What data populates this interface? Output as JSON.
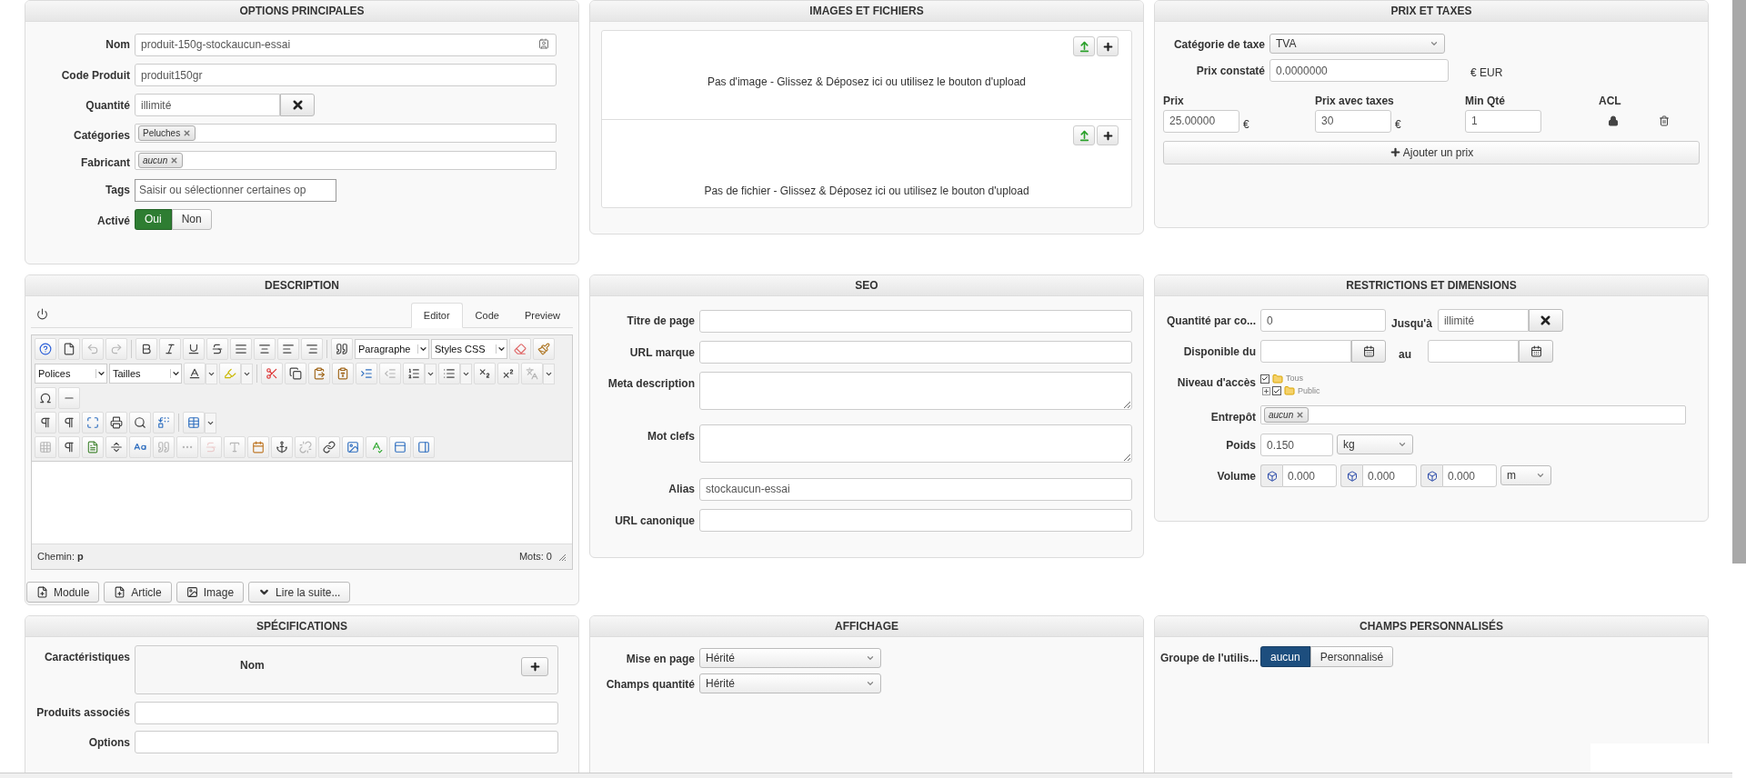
{
  "main_options": {
    "title": "OPTIONS PRINCIPALES",
    "fields": [
      {
        "kind": "text_icon",
        "label": "Nom",
        "value": "produit-150g-stockaucun-essai"
      },
      {
        "kind": "text",
        "label": "Code Produit",
        "value": "produit150gr"
      },
      {
        "kind": "clearable",
        "label": "Quantité",
        "value": "illimité"
      },
      {
        "kind": "tags",
        "label": "Catégories",
        "tags": [
          {
            "label": "Peluches",
            "italic": false
          }
        ]
      },
      {
        "kind": "tags",
        "label": "Fabricant",
        "tags": [
          {
            "label": "aucun",
            "italic": true
          }
        ]
      },
      {
        "kind": "placeholder",
        "label": "Tags",
        "placeholder": "Saisir ou sélectionner certaines op"
      },
      {
        "kind": "toggle",
        "label": "Activé",
        "color": "#2e7d32",
        "options": [
          {
            "label": "Oui",
            "selected": true
          },
          {
            "label": "Non",
            "selected": false
          }
        ]
      }
    ]
  },
  "images": {
    "title": "IMAGES ET FICHIERS",
    "dropzones": [
      {
        "text": "Pas d'image - Glissez & Déposez ici ou utilisez le bouton d'upload"
      },
      {
        "text": "Pas de fichier - Glissez & Déposez ici ou utilisez le bouton d'upload"
      }
    ]
  },
  "prices": {
    "title": "PRIX ET TAXES",
    "tax_category": {
      "label": "Catégorie de taxe",
      "value": "TVA"
    },
    "list_price": {
      "label": "Prix constaté",
      "value": "0.0000000",
      "currency": "€ EUR"
    },
    "price_columns": [
      "Prix",
      "Prix avec taxes",
      "Min Qté",
      "ACL"
    ],
    "price_rows": [
      {
        "price": "25.00000",
        "price_currency": "€",
        "price_tax": "30",
        "tax_currency": "€",
        "min_qty": "1"
      }
    ],
    "add_button": "Ajouter un prix"
  },
  "description": {
    "title": "DESCRIPTION",
    "tabs": [
      {
        "label": "Editor",
        "selected": true
      },
      {
        "label": "Code",
        "selected": false
      },
      {
        "label": "Preview",
        "selected": false
      }
    ],
    "selects": [
      "Paragraphe",
      "Styles CSS",
      "Polices",
      "Tailles"
    ],
    "path": "Chemin: **p**",
    "word_count": "Mots: 0",
    "buttons": [
      {
        "label": "Module",
        "kind": "insert"
      },
      {
        "label": "Article",
        "kind": "insert"
      },
      {
        "label": "Image",
        "kind": "image"
      },
      {
        "label": "Lire la suite...",
        "kind": "readmore"
      }
    ]
  },
  "seo": {
    "title": "SEO",
    "fields": [
      {
        "kind": "text",
        "label": "Titre de page"
      },
      {
        "kind": "text",
        "label": "URL marque"
      },
      {
        "kind": "textarea",
        "label": "Meta description"
      },
      {
        "kind": "textarea",
        "label": "Mot clefs"
      },
      {
        "kind": "text",
        "label": "Alias",
        "value": "stockaucun-essai"
      },
      {
        "kind": "text",
        "label": "URL canonique"
      }
    ]
  },
  "restrictions": {
    "title": "RESTRICTIONS ET DIMENSIONS",
    "fields": [
      {
        "kind": "quantity_range",
        "label": "Quantité par co...",
        "value": "0",
        "to_label": "Jusqu'à",
        "to_value": "illimité"
      },
      {
        "kind": "date_range",
        "label": "Disponible du",
        "to_label": "au"
      },
      {
        "kind": "tree",
        "label": "Niveau d'accès",
        "items": [
          {
            "label": "Tous",
            "checked": true,
            "children": [
              {
                "label": "Public",
                "checked": true,
                "expanded": false
              }
            ]
          }
        ]
      },
      {
        "kind": "tags",
        "label": "Entrepôt",
        "tags": [
          {
            "label": "aucun",
            "italic": true
          }
        ]
      },
      {
        "kind": "unit",
        "label": "Poids",
        "value": "0.150",
        "unit": "kg"
      },
      {
        "kind": "volume",
        "label": "Volume",
        "values": [
          "0.000",
          "0.000",
          "0.000"
        ],
        "unit": "m"
      }
    ]
  },
  "specifications": {
    "title": "SPÉCIFICATIONS",
    "fields": [
      {
        "kind": "features",
        "label": "Caractéristiques",
        "column": "Nom"
      },
      {
        "kind": "text",
        "label": "Produits associés"
      },
      {
        "kind": "text",
        "label": "Options"
      }
    ]
  },
  "display": {
    "title": "AFFICHAGE",
    "fields": [
      {
        "kind": "select",
        "label": "Mise en page",
        "value": "Hérité"
      },
      {
        "kind": "select",
        "label": "Champs quantité",
        "value": "Hérité"
      }
    ]
  },
  "custom_fields": {
    "title": "CHAMPS PERSONNALISÉS",
    "fields": [
      {
        "kind": "toggle",
        "label": "Groupe de l'utilis...",
        "color": "#1d4e7e",
        "options": [
          {
            "label": "aucun",
            "selected": true
          },
          {
            "label": "Personnalisé",
            "selected": false
          }
        ]
      }
    ]
  }
}
